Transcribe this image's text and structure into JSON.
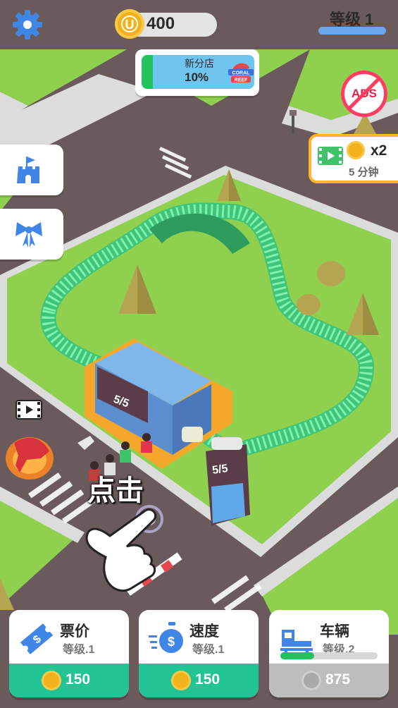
{
  "header": {
    "coins": "400",
    "level_label": "等级 1"
  },
  "new_store": {
    "title": "新分店",
    "progress_text": "10%",
    "progress": 0.1,
    "logo_text": "CORAL REEF"
  },
  "ads_button": {
    "label": "ADS"
  },
  "boost": {
    "multiplier": "x2",
    "duration": "5 分钟"
  },
  "scene": {
    "station_sign": "5/5",
    "queue_sign": "5/5",
    "tap_hint": "点击"
  },
  "upgrades": [
    {
      "title": "票价",
      "level": "等级.1",
      "price": "150",
      "enabled": true
    },
    {
      "title": "速度",
      "level": "等级.1",
      "price": "150",
      "enabled": true
    },
    {
      "title": "车辆",
      "level": "等级.2",
      "price": "875",
      "enabled": false,
      "progress": 0.35
    }
  ],
  "colors": {
    "grass": "#8fd14f",
    "road": "#6b5a5c",
    "track": "#4fd68a",
    "buy_green": "#22c493",
    "coin": "#f3b21c",
    "level_bar": "#6aa5e8"
  },
  "icons": {
    "settings": "gear-icon",
    "castle": "castle-icon",
    "bow": "bow-icon",
    "ticket": "ticket-icon",
    "speed": "stopwatch-dollar-icon",
    "vehicle": "coaster-car-icon"
  }
}
